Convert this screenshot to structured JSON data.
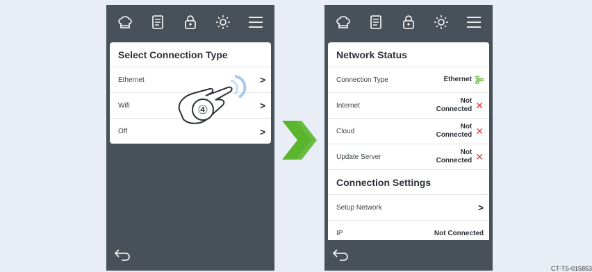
{
  "icons": {
    "topbar": [
      "chef-hat-icon",
      "recipe-book-icon",
      "lock-icon",
      "brightness-icon",
      "menu-icon"
    ],
    "bottom": "back-arrow-icon",
    "arrow": "double-chevron-right-icon"
  },
  "left_screen": {
    "title": "Select Connection Type",
    "options": [
      "Ethernet",
      "Wifi",
      "Off"
    ],
    "step_marker": "④"
  },
  "right_screen": {
    "status_title": "Network Status",
    "status_rows": [
      {
        "label": "Connection Type",
        "value": "Ethernet"
      },
      {
        "label": "Internet",
        "value": "Not Connected"
      },
      {
        "label": "Cloud",
        "value": "Not Connected"
      },
      {
        "label": "Update Server",
        "value": "Not Connected"
      }
    ],
    "settings_title": "Connection Settings",
    "settings_rows": [
      {
        "label": "Setup Network"
      },
      {
        "label": "IP",
        "value": "Not Connected"
      }
    ]
  },
  "watermark": "CT-TS-015853",
  "colors": {
    "phone_bg": "#48505a",
    "accent_green": "#5ab52c",
    "error_red": "#e03c3c",
    "page_bg": "#e9eef6"
  }
}
